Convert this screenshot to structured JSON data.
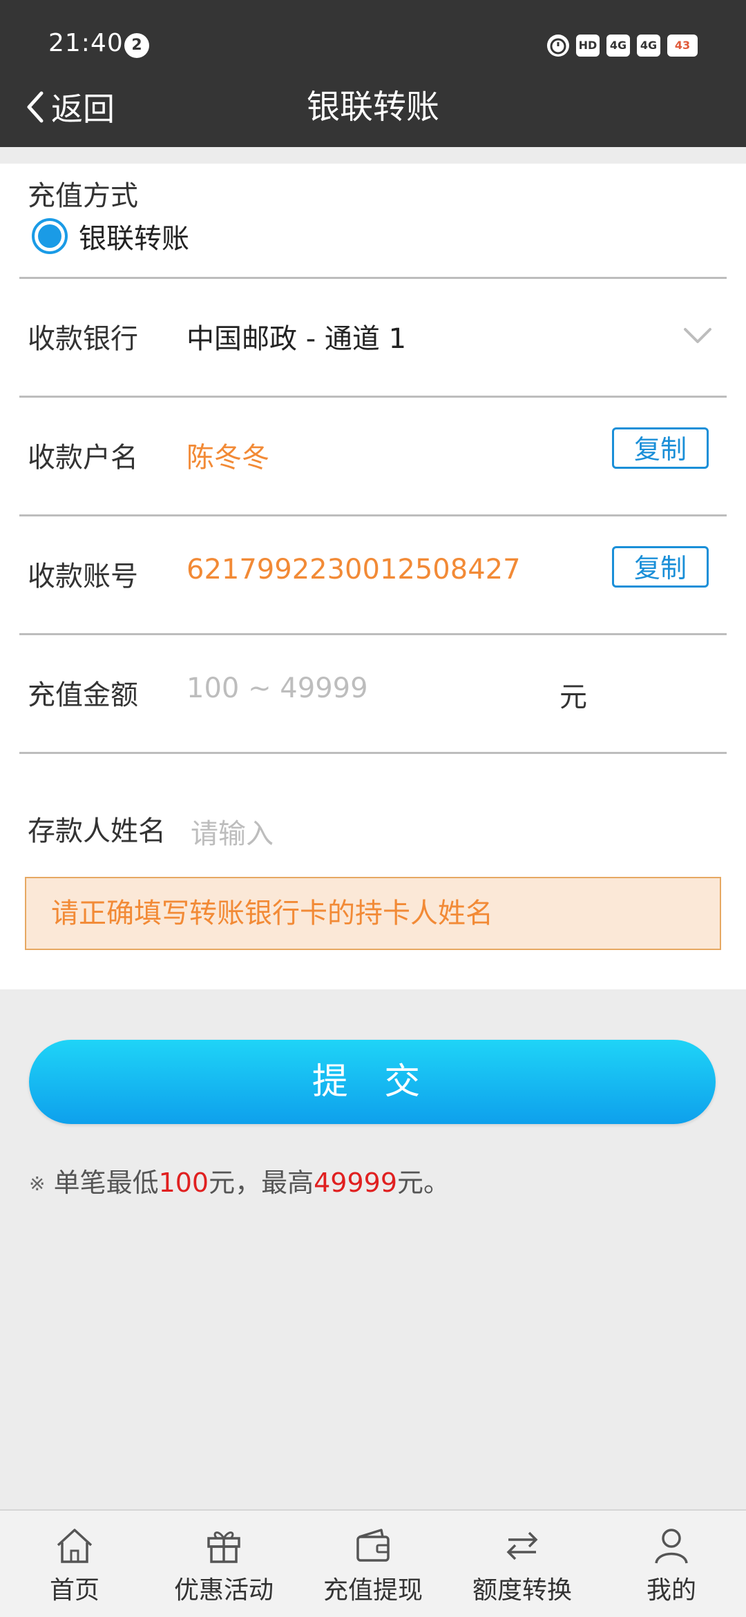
{
  "status_bar": {
    "time": "21:40",
    "notification_count": "2",
    "icons": [
      "alarm-icon",
      "hd-icon",
      "signal-4g-icon",
      "signal-4g-icon",
      "battery-icon"
    ],
    "hd_label": "HD",
    "sig1_label": "4G",
    "sig2_label": "4G",
    "battery_level": "43"
  },
  "header": {
    "back_label": "返回",
    "title": "银联转账"
  },
  "form": {
    "method_label": "充值方式",
    "method_option": "银联转账",
    "bank_label": "收款银行",
    "bank_value": "中国邮政 - 通道 1",
    "name_label": "收款户名",
    "name_value": "陈冬冬",
    "copy_label": "复制",
    "account_label": "收款账号",
    "account_value": "6217992230012508427",
    "amount_label": "充值金额",
    "amount_placeholder": "100 ~ 49999",
    "amount_unit": "元",
    "depositor_label": "存款人姓名",
    "depositor_placeholder": "请输入",
    "notice": "请正确填写转账银行卡的持卡人姓名"
  },
  "submit_label": "提 交",
  "limit": {
    "star": "※",
    "prefix": "单笔最低",
    "min": "100",
    "middle": "元，最高",
    "max": "49999",
    "suffix": "元。"
  },
  "bottom_nav": {
    "items": [
      {
        "label": "首页",
        "icon": "home-icon"
      },
      {
        "label": "优惠活动",
        "icon": "gift-icon"
      },
      {
        "label": "充值提现",
        "icon": "wallet-icon"
      },
      {
        "label": "额度转换",
        "icon": "transfer-icon"
      },
      {
        "label": "我的",
        "icon": "user-icon"
      }
    ]
  },
  "colors": {
    "header_bg": "#353535",
    "accent_blue": "#1a9be6",
    "orange": "#f28a36",
    "red": "#e02020"
  }
}
